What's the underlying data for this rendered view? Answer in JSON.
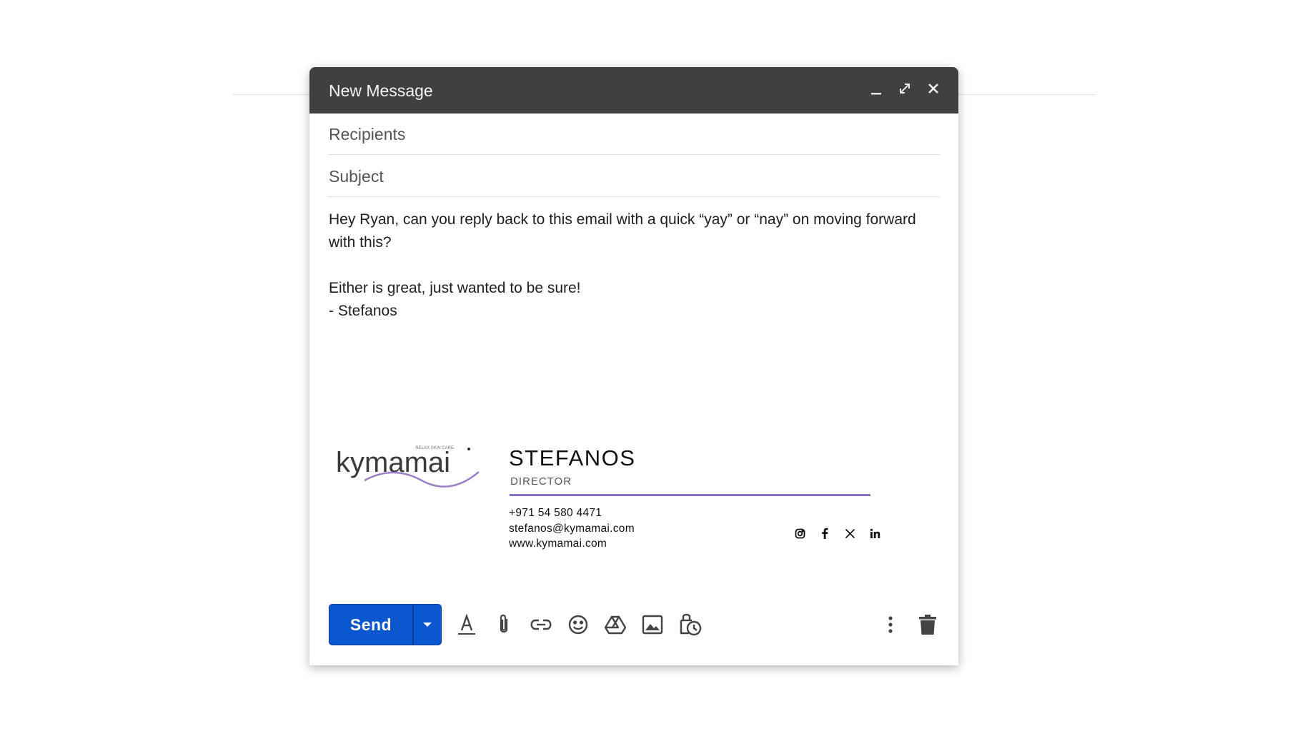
{
  "window": {
    "title": "New Message",
    "controls": [
      "minimize-icon",
      "expand-icon",
      "close-icon"
    ]
  },
  "fields": {
    "recipients_placeholder": "Recipients",
    "subject_placeholder": "Subject"
  },
  "body": {
    "line1": "Hey Ryan, can you reply back to this email with a quick “yay” or “nay” on moving forward with this?",
    "line2": "Either is great, just wanted to be sure!",
    "line3": "- Stefanos"
  },
  "signature": {
    "logo_text": "kymamai",
    "logo_tagline": "RELAX SKIN CARE",
    "name": "STEFANOS",
    "role": "DIRECTOR",
    "phone": "+971 54 580 4471",
    "email": "stefanos@kymamai.com",
    "website": "www.kymamai.com",
    "social": [
      "instagram-icon",
      "facebook-icon",
      "x-icon",
      "linkedin-icon"
    ],
    "accent_color": "#8c6fbf"
  },
  "toolbar": {
    "send_label": "Send",
    "send_color": "#0b57d0",
    "tools": [
      "text-format-icon",
      "attach-icon",
      "link-icon",
      "emoji-icon",
      "drive-icon",
      "photo-icon",
      "schedule-icon"
    ],
    "right_tools": [
      "more-options-icon",
      "discard-icon"
    ]
  }
}
